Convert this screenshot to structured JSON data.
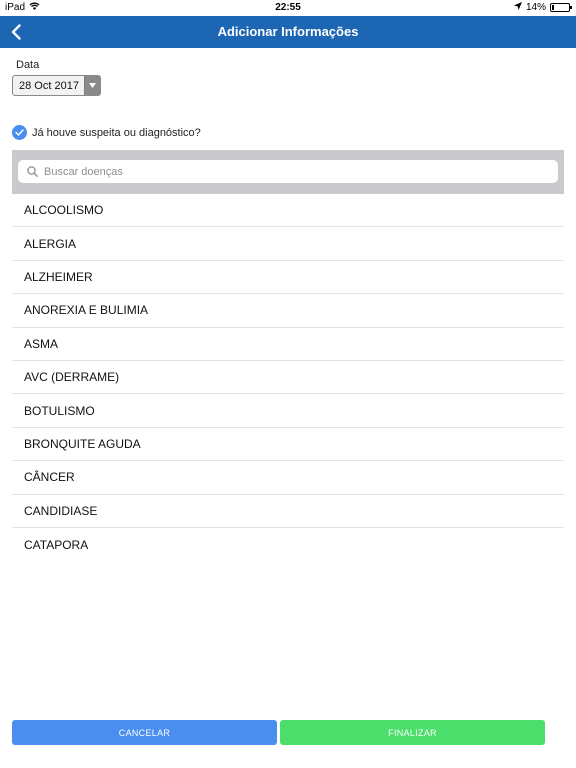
{
  "status_bar": {
    "device": "iPad",
    "time": "22:55",
    "battery_text": "14%",
    "battery_level": 0.14
  },
  "nav": {
    "title": "Adicionar Informações"
  },
  "date": {
    "label": "Data",
    "value": "28 Oct 2017"
  },
  "suspicion": {
    "label": "Já houve suspeita ou diagnóstico?",
    "checked": true
  },
  "search": {
    "placeholder": "Buscar doenças"
  },
  "diseases": [
    "ALCOOLISMO",
    "ALERGIA",
    "ALZHEIMER",
    "ANOREXIA E BULIMIA",
    "ASMA",
    "AVC (DERRAME)",
    "BOTULISMO",
    "BRONQUITE AGUDA",
    "CÂNCER",
    "CANDIDIASE",
    "CATAPORA"
  ],
  "buttons": {
    "cancel_label": "CANCELAR",
    "finish_label": "FINALIZAR"
  },
  "colors": {
    "nav_bar": "#1c66b3",
    "cancel_button": "#4a8ff0",
    "finish_button": "#4bde6a",
    "checkbox": "#4a8ff0"
  },
  "icons": [
    "wifi-icon",
    "back-chevron-icon",
    "location-arrow-icon",
    "battery-icon",
    "dropdown-arrow-icon",
    "checkmark-icon",
    "search-icon"
  ]
}
